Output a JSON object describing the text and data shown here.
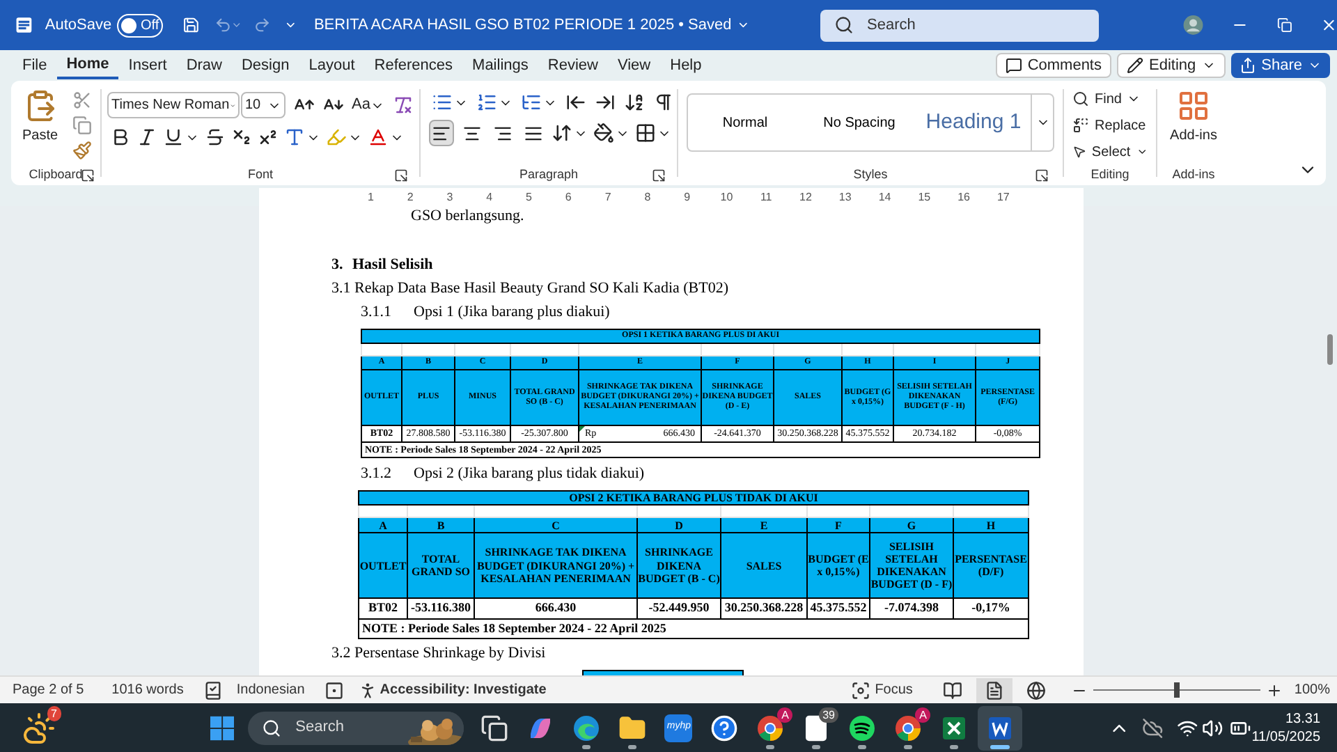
{
  "title_bar": {
    "autosave_label": "AutoSave",
    "autosave_toggle": {
      "label": "Off",
      "on": false
    },
    "document_title": "BERITA ACARA HASIL GSO BT02 PERIODE 1 2025 • Saved",
    "search_placeholder": "Search"
  },
  "menu_tabs": [
    {
      "label": "File",
      "selected": false
    },
    {
      "label": "Home",
      "selected": true
    },
    {
      "label": "Insert",
      "selected": false
    },
    {
      "label": "Draw",
      "selected": false
    },
    {
      "label": "Design",
      "selected": false
    },
    {
      "label": "Layout",
      "selected": false
    },
    {
      "label": "References",
      "selected": false
    },
    {
      "label": "Mailings",
      "selected": false
    },
    {
      "label": "Review",
      "selected": false
    },
    {
      "label": "View",
      "selected": false
    },
    {
      "label": "Help",
      "selected": false
    }
  ],
  "header_buttons": [
    {
      "kind": "comments",
      "label": "Comments"
    },
    {
      "kind": "editing",
      "label": "Editing"
    },
    {
      "kind": "share",
      "label": "Share"
    }
  ],
  "ribbon": {
    "clipboard": {
      "paste_label": "Paste",
      "group_label": "Clipboard"
    },
    "font": {
      "font_name": "Times New Roman",
      "font_size": "10",
      "case_label": "Aa",
      "group_label": "Font"
    },
    "paragraph": {
      "alignments": [
        {
          "kind": "left",
          "selected": true
        },
        {
          "kind": "center",
          "selected": false
        },
        {
          "kind": "right",
          "selected": false
        },
        {
          "kind": "justify",
          "selected": false
        }
      ],
      "group_label": "Paragraph"
    },
    "styles": {
      "items": [
        {
          "kind": "normal",
          "label": "Normal"
        },
        {
          "kind": "plain",
          "label": "No Spacing"
        },
        {
          "kind": "heading",
          "label": "Heading 1"
        }
      ],
      "group_label": "Styles"
    },
    "editing": {
      "items": [
        {
          "kind": "find",
          "label": "Find"
        },
        {
          "kind": "replace",
          "label": "Replace"
        },
        {
          "kind": "select",
          "label": "Select"
        }
      ],
      "group_label": "Editing"
    },
    "addins": {
      "label": "Add-ins",
      "group_label": "Add-ins"
    }
  },
  "ruler": {
    "ticks": [
      "1",
      "2",
      "3",
      "4",
      "5",
      "6",
      "7",
      "8",
      "9",
      "10",
      "11",
      "12",
      "13",
      "14",
      "15",
      "16",
      "17"
    ]
  },
  "document": {
    "blocks": [
      {
        "kind": "continuation",
        "text": "GSO berlangsung."
      },
      {
        "kind": "heading",
        "number": "3.",
        "text": "Hasil Selisih"
      },
      {
        "kind": "section",
        "text": "3.1 Rekap Data Base Hasil Beauty Grand SO Kali Kadia (BT02)"
      },
      {
        "kind": "subsection",
        "number": "3.1.1",
        "text": "Opsi 1 (Jika barang plus diakui)"
      },
      {
        "kind": "table",
        "title": "OPSI 1 KETIKA BARANG PLUS DI AKUI",
        "columns": [
          {
            "letter": "A",
            "header": "OUTLET"
          },
          {
            "letter": "B",
            "header": "PLUS"
          },
          {
            "letter": "C",
            "header": "MINUS"
          },
          {
            "letter": "D",
            "header": "TOTAL GRAND SO (B - C)"
          },
          {
            "letter": "E",
            "header": "SHRINKAGE TAK DIKENA BUDGET (DIKURANGI 20%) + KESALAHAN PENERIMAAN"
          },
          {
            "letter": "F",
            "header": "SHRINKAGE DIKENA BUDGET (D - E)"
          },
          {
            "letter": "G",
            "header": "SALES"
          },
          {
            "letter": "H",
            "header": "BUDGET (G x 0,15%)"
          },
          {
            "letter": "I",
            "header": "SELISIH SETELAH DIKENAKAN BUDGET (F - H)"
          },
          {
            "letter": "J",
            "header": "PERSENTASE (F/G)"
          }
        ],
        "rows": [
          [
            {
              "text": "BT02"
            },
            {
              "text": "27.808.580"
            },
            {
              "text": "-53.116.380"
            },
            {
              "text": "-25.307.800"
            },
            {
              "prefix": "Rp",
              "text": "666.430",
              "flagged": true
            },
            {
              "text": "-24.641.370"
            },
            {
              "text": "30.250.368.228"
            },
            {
              "text": "45.375.552"
            },
            {
              "text": "20.734.182"
            },
            {
              "text": "-0,08%"
            }
          ]
        ],
        "note": "NOTE : Periode Sales 18 September 2024 - 22 April 2025"
      },
      {
        "kind": "subsection",
        "number": "3.1.2",
        "text": "Opsi 2 (Jika barang plus tidak diakui)"
      },
      {
        "kind": "table",
        "title": "OPSI 2 KETIKA BARANG PLUS TIDAK DI AKUI",
        "columns": [
          {
            "letter": "A",
            "header": "OUTLET"
          },
          {
            "letter": "B",
            "header": "TOTAL GRAND SO"
          },
          {
            "letter": "C",
            "header": "SHRINKAGE TAK DIKENA BUDGET (DIKURANGI 20%) + KESALAHAN PENERIMAAN"
          },
          {
            "letter": "D",
            "header": "SHRINKAGE DIKENA BUDGET (B - C)"
          },
          {
            "letter": "E",
            "header": "SALES"
          },
          {
            "letter": "F",
            "header": "BUDGET (E x 0,15%)"
          },
          {
            "letter": "G",
            "header": "SELISIH SETELAH DIKENAKAN BUDGET (D - F)"
          },
          {
            "letter": "H",
            "header": "PERSENTASE (D/F)"
          }
        ],
        "rows": [
          [
            {
              "text": "BT02"
            },
            {
              "text": "-53.116.380"
            },
            {
              "text": "666.430"
            },
            {
              "text": "-52.449.950"
            },
            {
              "text": "30.250.368.228"
            },
            {
              "text": "45.375.552"
            },
            {
              "text": "-7.074.398"
            },
            {
              "text": "-0,17%"
            }
          ]
        ],
        "note": "NOTE : Periode Sales 18 September 2024 - 22 April 2025"
      },
      {
        "kind": "section",
        "text": "3.2 Persentase Shrinkage by Divisi"
      },
      {
        "kind": "table_stub"
      }
    ]
  },
  "status_bar": {
    "page": "Page 2 of 5",
    "words": "1016 words",
    "language": "Indonesian",
    "accessibility": "Accessibility: Investigate",
    "focus": "Focus",
    "views": [
      {
        "kind": "read",
        "selected": false
      },
      {
        "kind": "print",
        "selected": true
      },
      {
        "kind": "web",
        "selected": false
      }
    ],
    "zoom": {
      "level": 0.5,
      "reading": "100%"
    }
  },
  "taskbar": {
    "weather_badge": "7",
    "search_placeholder": "Search",
    "apps": [
      {
        "kind": "task_view",
        "running": false,
        "active": false
      },
      {
        "kind": "copilot",
        "running": false,
        "active": false
      },
      {
        "kind": "edge",
        "running": true,
        "active": false
      },
      {
        "kind": "explorer",
        "running": true,
        "active": false
      },
      {
        "kind": "myhp",
        "label": "myhp",
        "running": false,
        "active": false
      },
      {
        "kind": "help",
        "running": false,
        "active": false
      },
      {
        "kind": "chrome",
        "badge": "A",
        "running": true,
        "active": false
      },
      {
        "kind": "file",
        "badge": "39",
        "running": true,
        "active": false
      },
      {
        "kind": "spotify",
        "running": true,
        "active": false
      },
      {
        "kind": "chrome",
        "badge": "A",
        "running": true,
        "active": false
      },
      {
        "kind": "excel",
        "running": true,
        "active": false
      },
      {
        "kind": "word",
        "running": true,
        "active": true
      }
    ],
    "time": "13.31",
    "date": "11/05/2025"
  }
}
